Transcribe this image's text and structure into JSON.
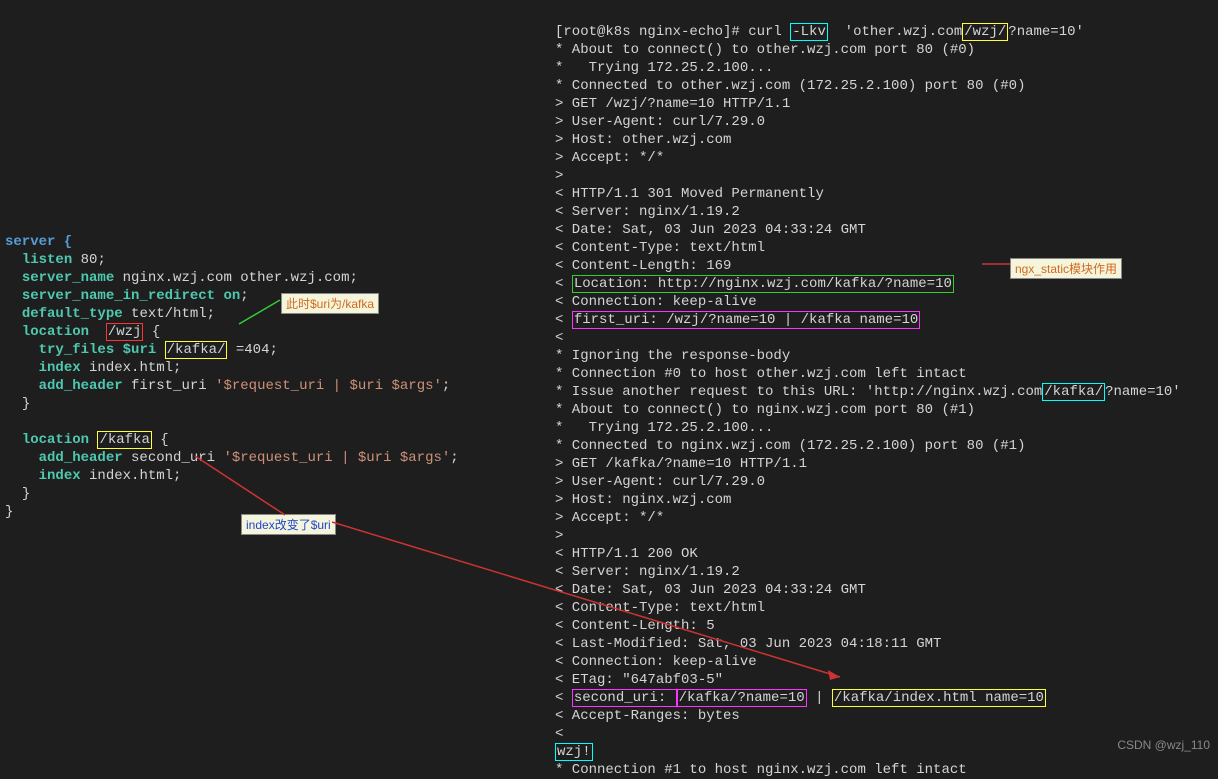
{
  "nginx": {
    "server_open": "server {",
    "listen": "listen",
    "listen_val": "80",
    "sname": "server_name",
    "sname_val": "nginx.wzj.com other.wzj.com",
    "sredir": "server_name_in_redirect",
    "sredir_val": "on",
    "dtype": "default_type",
    "dtype_val": "text/html",
    "loc1": "location",
    "loc1_path": "/wzj",
    "loc1_open": "{",
    "try": "try_files",
    "try_var": "$uri",
    "try_path": "/kafka/",
    "try_rest": "=404",
    "index": "index",
    "index_val": "index.html",
    "addh": "add_header",
    "addh1_name": "first_uri",
    "addh1_val": "'$request_uri | $uri $args'",
    "loc1_close": "}",
    "loc2": "location",
    "loc2_path": "/kafka",
    "loc2_open": "{",
    "addh2_name": "second_uri",
    "addh2_val": "'$request_uri | $uri $args'",
    "loc2_close": "}",
    "server_close": "}"
  },
  "curl": {
    "prompt": "[root@k8s nginx-echo]# curl ",
    "flag": "-Lkv",
    "urlpre": "  'other.wzj.com",
    "urlhl": "/wzj/",
    "urlpost": "?name=10'",
    "l1": "* About to connect() to other.wzj.com port 80 (#0)",
    "l2": "*   Trying 172.25.2.100...",
    "l3": "* Connected to other.wzj.com (172.25.2.100) port 80 (#0)",
    "l4": "> GET /wzj/?name=10 HTTP/1.1",
    "l5": "> User-Agent: curl/7.29.0",
    "l6": "> Host: other.wzj.com",
    "l7": "> Accept: */*",
    "l8": ">",
    "l9": "< HTTP/1.1 301 Moved Permanently",
    "l10": "< Server: nginx/1.19.2",
    "l11": "< Date: Sat, 03 Jun 2023 04:33:24 GMT",
    "l12": "< Content-Type: text/html",
    "l13": "< Content-Length: 169",
    "lochdr_lt": "< ",
    "lochdr": "Location: http://nginx.wzj.com/kafka/?name=10",
    "l15": "< Connection: keep-alive",
    "firsturi_lt": "< ",
    "firsturi": "first_uri: /wzj/?name=10 | /kafka name=10",
    "l17": "<",
    "l18": "* Ignoring the response-body",
    "l19": "* Connection #0 to host other.wzj.com left intact",
    "l20a": "* Issue another request to this URL: 'http://nginx.wzj.com",
    "l20hl": "/kafka/",
    "l20b": "?name=10'",
    "l21": "* About to connect() to nginx.wzj.com port 80 (#1)",
    "l22": "*   Trying 172.25.2.100...",
    "l23": "* Connected to nginx.wzj.com (172.25.2.100) port 80 (#1)",
    "l24": "> GET /kafka/?name=10 HTTP/1.1",
    "l25": "> User-Agent: curl/7.29.0",
    "l26": "> Host: nginx.wzj.com",
    "l27": "> Accept: */*",
    "l28": ">",
    "l29": "< HTTP/1.1 200 OK",
    "l30": "< Server: nginx/1.19.2",
    "l31": "< Date: Sat, 03 Jun 2023 04:33:24 GMT",
    "l32": "< Content-Type: text/html",
    "l33": "< Content-Length: 5",
    "l34": "< Last-Modified: Sat, 03 Jun 2023 04:18:11 GMT",
    "l35": "< Connection: keep-alive",
    "l36": "< ETag: \"647abf03-5\"",
    "seclt": "< ",
    "secname": "second_uri: ",
    "sechl1": "/kafka/?name=10",
    "secmid": " | ",
    "sechl2": "/kafka/index.html name=10",
    "l38": "< Accept-Ranges: bytes",
    "l39": "<",
    "body": "wzj!",
    "l41": "* Connection #1 to host nginx.wzj.com left intact"
  },
  "annotations": {
    "a1": "此时$uri为/kafka",
    "a2": "index改变了$uri",
    "a3": "ngx_static模块作用"
  },
  "watermark": "CSDN @wzj_110"
}
